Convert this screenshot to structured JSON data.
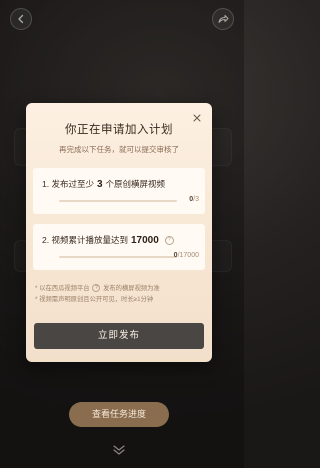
{
  "modal": {
    "title": "你正在申请加入计划",
    "subtitle": "再完成以下任务，就可以提交审核了",
    "tasks": [
      {
        "prefix": "1. 发布过至少",
        "target": "3",
        "suffix": "个原创横屏视频",
        "current": "0",
        "total": "/3",
        "progress_fraction": 0
      },
      {
        "prefix": "2. 视频累计播放量达到",
        "target": "17000",
        "suffix": "",
        "current": "0",
        "total": "/17000",
        "progress_fraction": 0
      }
    ],
    "notes": [
      {
        "before": "* 以在西瓜视频平台",
        "after": "发布的横屏视频为准"
      },
      {
        "text": "* 视频需声明原创且公开可见，时长≥1分钟"
      }
    ],
    "publish_label": "立即发布"
  },
  "footer": {
    "progress_label": "查看任务进度"
  },
  "icons": {
    "back": "chevron-left-icon",
    "share": "share-arrow-icon",
    "close": "close-icon",
    "help": "question-circle-icon",
    "expand": "double-chevron-down-icon"
  },
  "colors": {
    "modal_bg": "#fdf0e2",
    "publish_button": "#4a4643",
    "progress_button": "#8a6d4e"
  }
}
